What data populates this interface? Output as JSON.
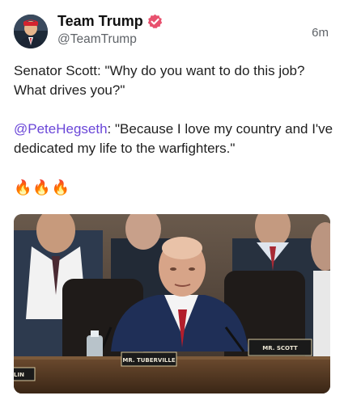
{
  "post": {
    "display_name": "Team Trump",
    "handle": "@TeamTrump",
    "timestamp": "6m",
    "paragraph1": "Senator Scott: \"Why do you want to do this job? What drives you?\"",
    "mention": "@PeteHegseth",
    "paragraph2_rest": ": \"Because I love my country and I've dedicated my life to the warfighters.\"",
    "emojis": "🔥🔥🔥"
  },
  "media": {
    "placards": {
      "scott": "MR. SCOTT",
      "tuberville": "MR. TUBERVILLE",
      "left_partial": "LIN"
    }
  },
  "colors": {
    "mention": "#6a46d8",
    "verified": "#e8516e",
    "muted_text": "#5f6368"
  },
  "icons": {
    "verified": "verified-badge-icon"
  }
}
